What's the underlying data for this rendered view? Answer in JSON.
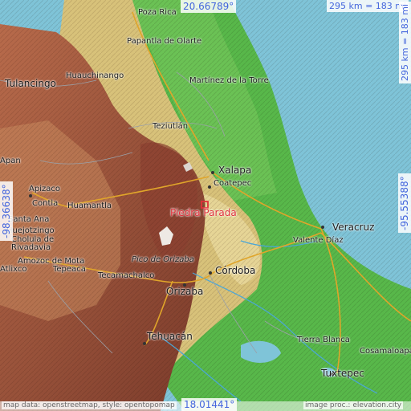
{
  "coordinates": {
    "north": "20.66789°",
    "south": "18.01441°",
    "west": "-98.36638°",
    "east": "-95.55388°"
  },
  "scale": {
    "top": "295 km = 183 mi",
    "right": "295 km = 183 mi"
  },
  "highlight": {
    "name": "Piedra Parada"
  },
  "cities": [
    "Poza Rica",
    "Papantla de Olarte",
    "Huauchinango",
    "Martínez de la Torre",
    "Tulancingo",
    "Teziutlán",
    "Xalapa",
    "Coatepec",
    "Apizaco",
    "Huamantla",
    "Contla",
    "Huejotzingo",
    "Cholula de Rivadavia",
    "Amozoc de Mota",
    "Atlixco",
    "Tepeaca",
    "Tecamachalco",
    "Veracruz",
    "Valente Díaz",
    "Córdoba",
    "Orizaba",
    "Tehuacán",
    "Tierra Blanca",
    "Cosamaloapan",
    "Tuxtepec",
    "Pico de Orizaba",
    "Santa Ana",
    "Apan"
  ],
  "credits": {
    "left": "map data: openstreetmap, style: opentopomap",
    "right": "image proc.: elevation.city"
  },
  "colors": {
    "sea": "#7fc4d8",
    "lowland": "#58b84a",
    "midland": "#d8c27a",
    "highland": "#a0573f",
    "marker": "#e0303a"
  }
}
